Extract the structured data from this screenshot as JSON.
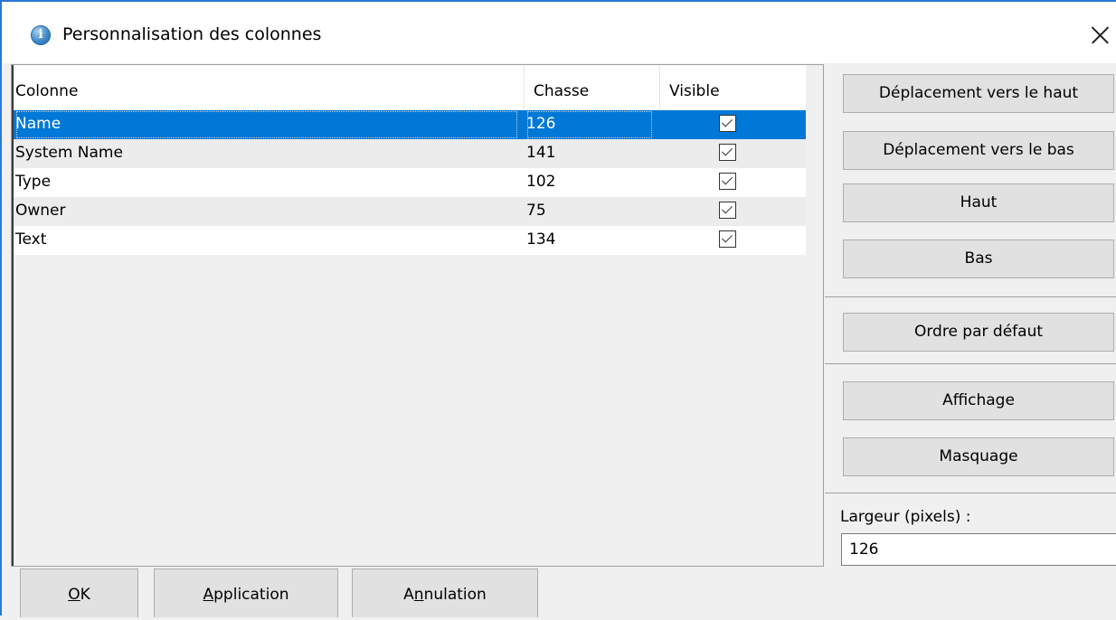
{
  "window": {
    "title": "Personnalisation des colonnes",
    "title_icon": "info-icon",
    "accent_color": "#2b79d8",
    "selection_color": "#0078d7"
  },
  "grid": {
    "headers": {
      "column": "Colonne",
      "width": "Chasse",
      "visible": "Visible"
    },
    "rows": [
      {
        "name": "Name",
        "width": "126",
        "visible": true,
        "selected": true
      },
      {
        "name": "System Name",
        "width": "141",
        "visible": true,
        "selected": false
      },
      {
        "name": "Type",
        "width": "102",
        "visible": true,
        "selected": false
      },
      {
        "name": "Owner",
        "width": "75",
        "visible": true,
        "selected": false
      },
      {
        "name": "Text",
        "width": "134",
        "visible": true,
        "selected": false
      }
    ]
  },
  "side": {
    "move_up": "Déplacement vers le haut",
    "move_down": "Déplacement vers le bas",
    "top": "Haut",
    "bottom": "Bas",
    "default_order": "Ordre par défaut",
    "show": "Affichage",
    "hide": "Masquage",
    "width_label": "Largeur (pixels) :",
    "width_value": "126"
  },
  "footer": {
    "ok": {
      "mnemonic": "O",
      "rest": "K"
    },
    "apply": {
      "mnemonic": "A",
      "rest": "pplication"
    },
    "cancel": {
      "before": "A",
      "mnemonic": "n",
      "rest": "nulation"
    }
  }
}
